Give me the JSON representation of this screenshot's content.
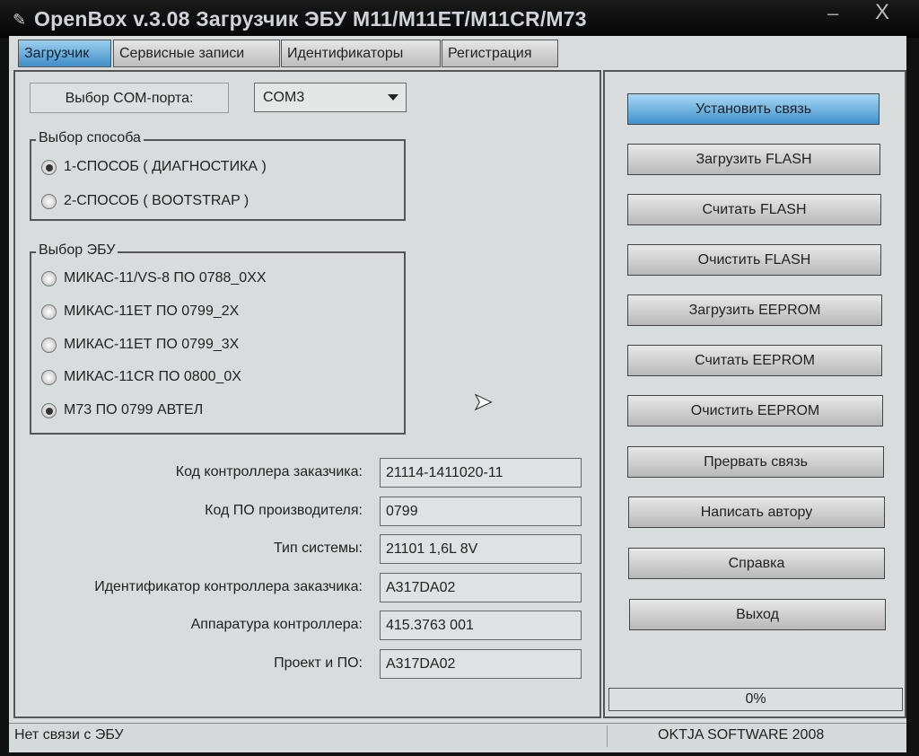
{
  "window": {
    "title": "OpenBox v.3.08 Загрузчик ЭБУ M11/M11ET/M11CR/M73",
    "minimize": "–",
    "close": "X"
  },
  "tabs": [
    {
      "label": "Загрузчик",
      "active": true
    },
    {
      "label": "Сервисные записи"
    },
    {
      "label": "Идентификаторы"
    },
    {
      "label": "Регистрация"
    }
  ],
  "com": {
    "label": "Выбор COM-порта:",
    "value": "COM3"
  },
  "method": {
    "legend": "Выбор способа",
    "options": [
      {
        "label": "1-СПОСОБ ( ДИАГНОСТИКА )",
        "checked": true
      },
      {
        "label": "2-СПОСОБ ( BOOTSTRAP )",
        "checked": false
      }
    ]
  },
  "ecu": {
    "legend": "Выбор ЭБУ",
    "options": [
      {
        "label": "МИКАС-11/VS-8 ПО 0788_0XX",
        "checked": false
      },
      {
        "label": "МИКАС-11ЕТ ПО 0799_2X",
        "checked": false
      },
      {
        "label": "МИКАС-11ЕТ ПО 0799_3X",
        "checked": false
      },
      {
        "label": "МИКАС-11CR ПО 0800_0X",
        "checked": false
      },
      {
        "label": "M73  ПО 0799 АВТЕЛ",
        "checked": true
      }
    ]
  },
  "fields": [
    {
      "label": "Код контроллера заказчика:",
      "value": "21114-1411020-11"
    },
    {
      "label": "Код ПО производителя:",
      "value": "0799"
    },
    {
      "label": "Тип системы:",
      "value": "21101 1,6L 8V"
    },
    {
      "label": "Идентификатор контроллера заказчика:",
      "value": "A317DA02"
    },
    {
      "label": "Аппаратура контроллера:",
      "value": "415.3763 001"
    },
    {
      "label": "Проект и ПО:",
      "value": "A317DA02"
    }
  ],
  "buttons": [
    "Установить связь",
    "Загрузить FLASH",
    "Считать FLASH",
    "Очистить FLASH",
    "Загрузить EEPROM",
    "Считать EEPROM",
    "Очистить EEPROM",
    "Прервать связь",
    "Написать автору",
    "Справка",
    "Выход"
  ],
  "progress": {
    "text": "0%",
    "value": 0
  },
  "status": {
    "left": "Нет связи с ЭБУ",
    "right": "OKTJA SOFTWARE 2008"
  }
}
